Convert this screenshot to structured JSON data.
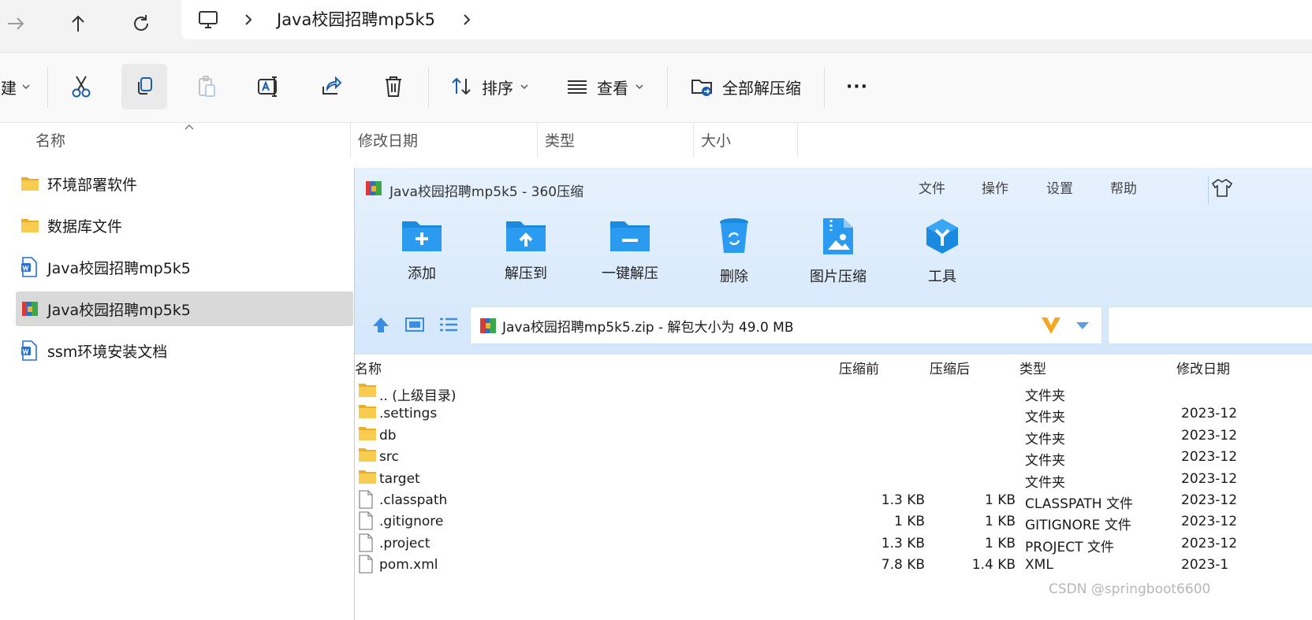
{
  "address": {
    "crumb": "Java校园招聘mp5k5"
  },
  "toolbar": {
    "new_partial": "建",
    "sort": "排序",
    "view": "查看",
    "extract_all": "全部解压缩",
    "more": "···"
  },
  "columns": {
    "name": "名称",
    "modified": "修改日期",
    "type": "类型",
    "size": "大小"
  },
  "files": [
    {
      "name": "环境部署软件",
      "icon": "folder-icon"
    },
    {
      "name": "数据库文件",
      "icon": "folder-icon"
    },
    {
      "name": "Java校园招聘mp5k5",
      "icon": "word-doc-icon"
    },
    {
      "name": "Java校园招聘mp5k5",
      "icon": "zip-archive-icon",
      "selected": true
    },
    {
      "name": "ssm环境安装文档",
      "icon": "word-doc-icon"
    }
  ],
  "zip": {
    "title": "Java校园招聘mp5k5 - 360压缩",
    "menu": [
      "文件",
      "操作",
      "设置",
      "帮助"
    ],
    "tools": [
      "添加",
      "解压到",
      "一键解压",
      "删除",
      "图片压缩",
      "工具"
    ],
    "path": "Java校园招聘mp5k5.zip - 解包大小为 49.0 MB",
    "list_headers": [
      "名称",
      "压缩前",
      "压缩后",
      "类型",
      "修改日期"
    ],
    "rows": [
      {
        "name": ".. (上级目录)",
        "before": "",
        "after": "",
        "type": "文件夹",
        "date": "",
        "icon": "folder-icon"
      },
      {
        "name": ".settings",
        "before": "",
        "after": "",
        "type": "文件夹",
        "date": "2023-12",
        "icon": "folder-icon"
      },
      {
        "name": "db",
        "before": "",
        "after": "",
        "type": "文件夹",
        "date": "2023-12",
        "icon": "folder-icon"
      },
      {
        "name": "src",
        "before": "",
        "after": "",
        "type": "文件夹",
        "date": "2023-12",
        "icon": "folder-icon"
      },
      {
        "name": "target",
        "before": "",
        "after": "",
        "type": "文件夹",
        "date": "2023-12",
        "icon": "folder-icon"
      },
      {
        "name": ".classpath",
        "before": "1.3 KB",
        "after": "1 KB",
        "type": "CLASSPATH 文件",
        "date": "2023-12",
        "icon": "file-icon"
      },
      {
        "name": ".gitignore",
        "before": "1 KB",
        "after": "1 KB",
        "type": "GITIGNORE 文件",
        "date": "2023-12",
        "icon": "file-icon"
      },
      {
        "name": ".project",
        "before": "1.3 KB",
        "after": "1 KB",
        "type": "PROJECT 文件",
        "date": "2023-12",
        "icon": "file-icon"
      },
      {
        "name": "pom.xml",
        "before": "7.8 KB",
        "after": "1.4 KB",
        "type": "XML",
        "date": "2023-1",
        "icon": "file-icon"
      }
    ],
    "watermark": "CSDN @springboot6600"
  }
}
